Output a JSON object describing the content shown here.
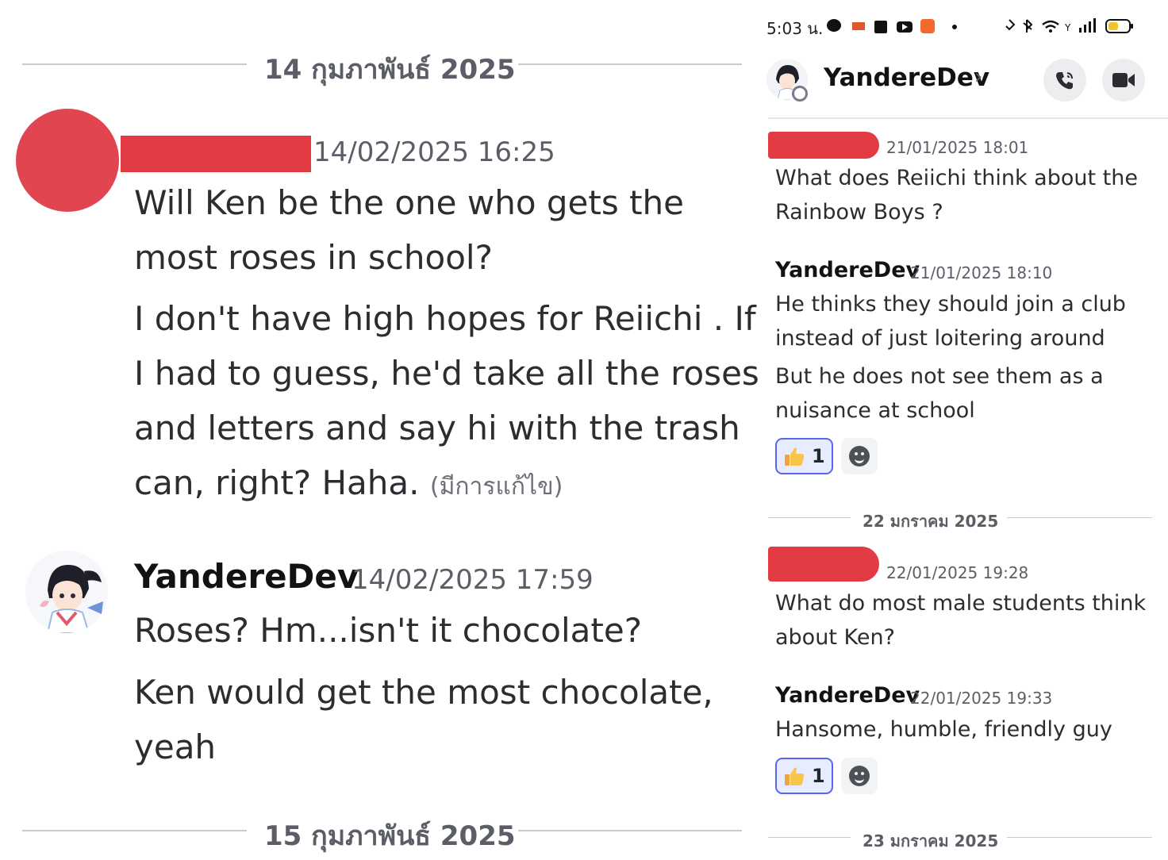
{
  "left": {
    "divider_top": "14 กุมภาพันธ์ 2025",
    "divider_bottom": "15 กุมภาพันธ์ 2025",
    "message1": {
      "timestamp": "14/02/2025 16:25",
      "line1": "Will Ken be the one who gets the",
      "line2": "most roses in school?",
      "line3": "I don't have high hopes for Reiichi . If",
      "line4": "I had to guess, he'd take all the roses",
      "line5": "and letters and say hi with the trash",
      "line6": "can, right? Haha.",
      "edited": "(มีการแก้ไข)"
    },
    "message2": {
      "author": "YandereDev",
      "timestamp": "14/02/2025 17:59",
      "line1": "Roses? Hm...isn't it chocolate?",
      "line2": "Ken would get the most chocolate,",
      "line3": "yeah"
    }
  },
  "right": {
    "status": {
      "time": "5:03 น."
    },
    "header": {
      "title": "YandereDev",
      "chevron": "›"
    },
    "msg1": {
      "timestamp": "21/01/2025 18:01",
      "line1": "What does Reiichi think about the",
      "line2": "Rainbow Boys ?"
    },
    "msg2": {
      "author": "YandereDev",
      "timestamp": "21/01/2025 18:10",
      "line1": "He thinks they should join a club",
      "line2": "instead of just loitering around",
      "line3": "But he does not see them as a",
      "line4": "nuisance at school",
      "reaction_count": "1"
    },
    "divider1": "22 มกราคม 2025",
    "msg3": {
      "timestamp": "22/01/2025 19:28",
      "line1": "What do most male students think",
      "line2": "about Ken?"
    },
    "msg4": {
      "author": "YandereDev",
      "timestamp": "22/01/2025 19:33",
      "line1": "Hansome, humble, friendly guy",
      "reaction_count": "1"
    },
    "divider2": "23 มกราคม 2025"
  },
  "icons": [
    "thumbs-up-icon",
    "add-reaction-icon",
    "phone-icon",
    "video-camera-icon",
    "chevron-right-icon",
    "avatar"
  ],
  "colors": {
    "redaction": "#e23b44",
    "reaction_border": "#5865f2",
    "reaction_bg": "#e8ecff"
  }
}
